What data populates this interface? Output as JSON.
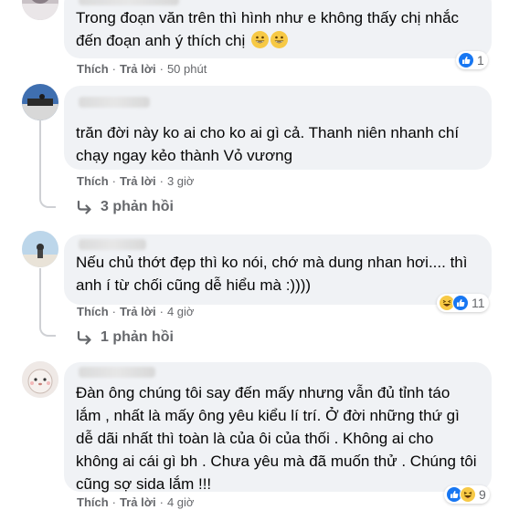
{
  "comments": [
    {
      "text": "Trong đoạn văn trên thì hình như e không thấy chị nhắc đến đoạn anh ý thích chị",
      "emojis": [
        "grin-emoji",
        "grin-emoji"
      ],
      "like_label": "Thích",
      "reply_label": "Trả lời",
      "time": "50 phút",
      "reaction_count": "1",
      "reaction_icons": [
        "like-reaction"
      ]
    },
    {
      "text": "trăn đời này ko ai cho ko ai gì cả. Thanh niên nhanh chí chạy ngay kẻo thành Vỏ vương",
      "like_label": "Thích",
      "reply_label": "Trả lời",
      "time": "3 giờ",
      "replies_label": "3 phản hồi"
    },
    {
      "text": "Nếu chủ thớt đẹp thì ko nói, chớ mà dung nhan hơi.... thì anh í từ chối cũng dễ hiểu mà :))))",
      "like_label": "Thích",
      "reply_label": "Trả lời",
      "time": "4 giờ",
      "reaction_count": "11",
      "reaction_icons": [
        "haha-reaction",
        "like-reaction"
      ],
      "replies_label": "1 phản hồi"
    },
    {
      "text": "Đàn ông chúng tôi say đến mấy nhưng vẫn đủ tỉnh táo lắm , nhất là mấy ông yêu kiểu lí trí. Ở đời những thứ gì dễ dãi nhất thì toàn là của ôi của thối . Không ai cho không ai cái gì bh . Chưa yêu mà đã muốn thử . Chúng tôi cũng sợ sida lắm !!!",
      "like_label": "Thích",
      "reply_label": "Trả lời",
      "time": "4 giờ",
      "reaction_count": "9",
      "reaction_icons": [
        "like-reaction",
        "haha-reaction"
      ]
    }
  ],
  "colors": {
    "bubble": "#f0f2f5",
    "meta": "#65676b",
    "like_blue": "#1877f2",
    "haha_yellow": "#f7c945"
  }
}
